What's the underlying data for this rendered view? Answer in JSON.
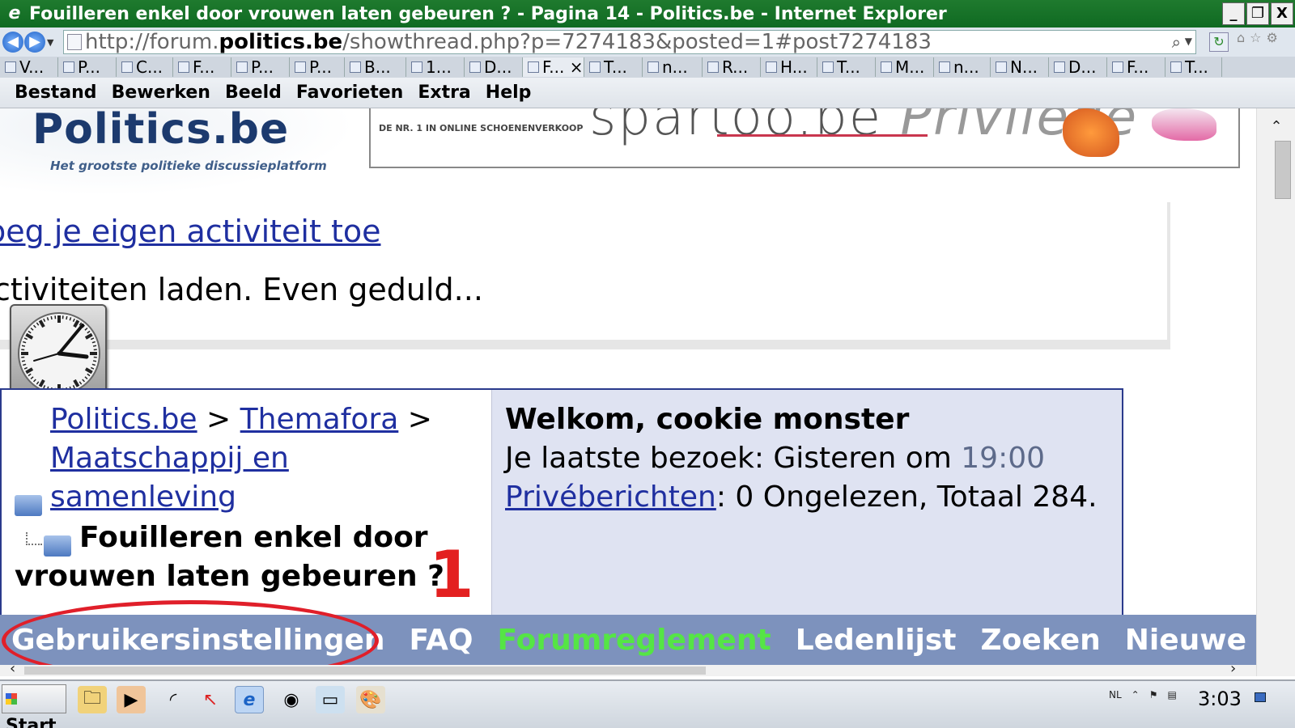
{
  "window": {
    "title": "Fouilleren enkel door vrouwen laten gebeuren ? - Pagina 14 - Politics.be - Internet Explorer",
    "minimize": "_",
    "restore": "❐",
    "close": "X"
  },
  "addressbar": {
    "url_prefix": "http://forum.",
    "url_domain": "politics.be",
    "url_path": "/showthread.php?p=7274183&posted=1#post7274183"
  },
  "favorites": [
    {
      "icon": "page-icon",
      "label": "V..."
    },
    {
      "icon": "page-icon",
      "label": "P..."
    },
    {
      "icon": "ie-icon",
      "label": "C..."
    },
    {
      "icon": "ds-icon",
      "label": "F..."
    },
    {
      "icon": "page-icon",
      "label": "P..."
    },
    {
      "icon": "page-icon",
      "label": "P..."
    },
    {
      "icon": "page-icon",
      "label": "B..."
    },
    {
      "icon": "page-icon",
      "label": "1..."
    },
    {
      "icon": "page-icon",
      "label": "D..."
    },
    {
      "icon": "page-icon",
      "label": "F... ×"
    },
    {
      "icon": "page-icon",
      "label": "T..."
    },
    {
      "icon": "ie-icon",
      "label": "n..."
    },
    {
      "icon": "wiki-icon",
      "label": "R..."
    },
    {
      "icon": "wiki-icon",
      "label": "H..."
    },
    {
      "icon": "youtube-icon",
      "label": "T..."
    },
    {
      "icon": "youtube-icon",
      "label": "M..."
    },
    {
      "icon": "g-icon",
      "label": "n..."
    },
    {
      "icon": "o-icon",
      "label": "N..."
    },
    {
      "icon": "wiki-icon",
      "label": "D..."
    },
    {
      "icon": "wiki-icon",
      "label": "F..."
    },
    {
      "icon": "ie-icon",
      "label": "T..."
    }
  ],
  "menu": [
    "Bestand",
    "Bewerken",
    "Beeld",
    "Favorieten",
    "Extra",
    "Help"
  ],
  "site": {
    "logo": "Politics.be",
    "tagline": "Het grootste politieke discussieplatform",
    "banner_sub": "DE NR. 1 IN ONLINE SCHOENENVERKOOP",
    "banner_main": "spartoo.be",
    "banner_priv": "Privilege"
  },
  "activity": {
    "add_link": "oeg je eigen activiteit toe",
    "loading": "ctiviteiten laden. Even geduld..."
  },
  "breadcrumb": {
    "root": "Politics.be",
    "sep": ">",
    "forum": "Themafora",
    "subforum_line1": "Maatschappij en",
    "subforum_line2": "samenleving",
    "thread_line1": "Fouilleren enkel door",
    "thread_line2": "vrouwen laten gebeuren ?"
  },
  "annotation": {
    "number": "1"
  },
  "user": {
    "welcome_prefix": "Welkom, ",
    "username": "cookie monster",
    "lastvisit_label": "Je laatste bezoek: Gisteren om ",
    "lastvisit_time": "19:00",
    "pm_link": "Privéberichten",
    "pm_text": ": 0 Ongelezen, Totaal 284."
  },
  "navlinks": {
    "settings": "Gebruikersinstellingen",
    "faq": "FAQ",
    "rules": "Forumreglement",
    "members": "Ledenlijst",
    "search": "Zoeken",
    "new": "Nieuwe berichten"
  },
  "taskbar": {
    "start": "Start",
    "lang": "NL",
    "time": "3:03"
  },
  "colors": {
    "titlebar": "#1f7a2e",
    "link": "#1f2fa0",
    "navbar": "#7d92bd",
    "rules_green": "#55e545",
    "annotation_red": "#e32020"
  }
}
